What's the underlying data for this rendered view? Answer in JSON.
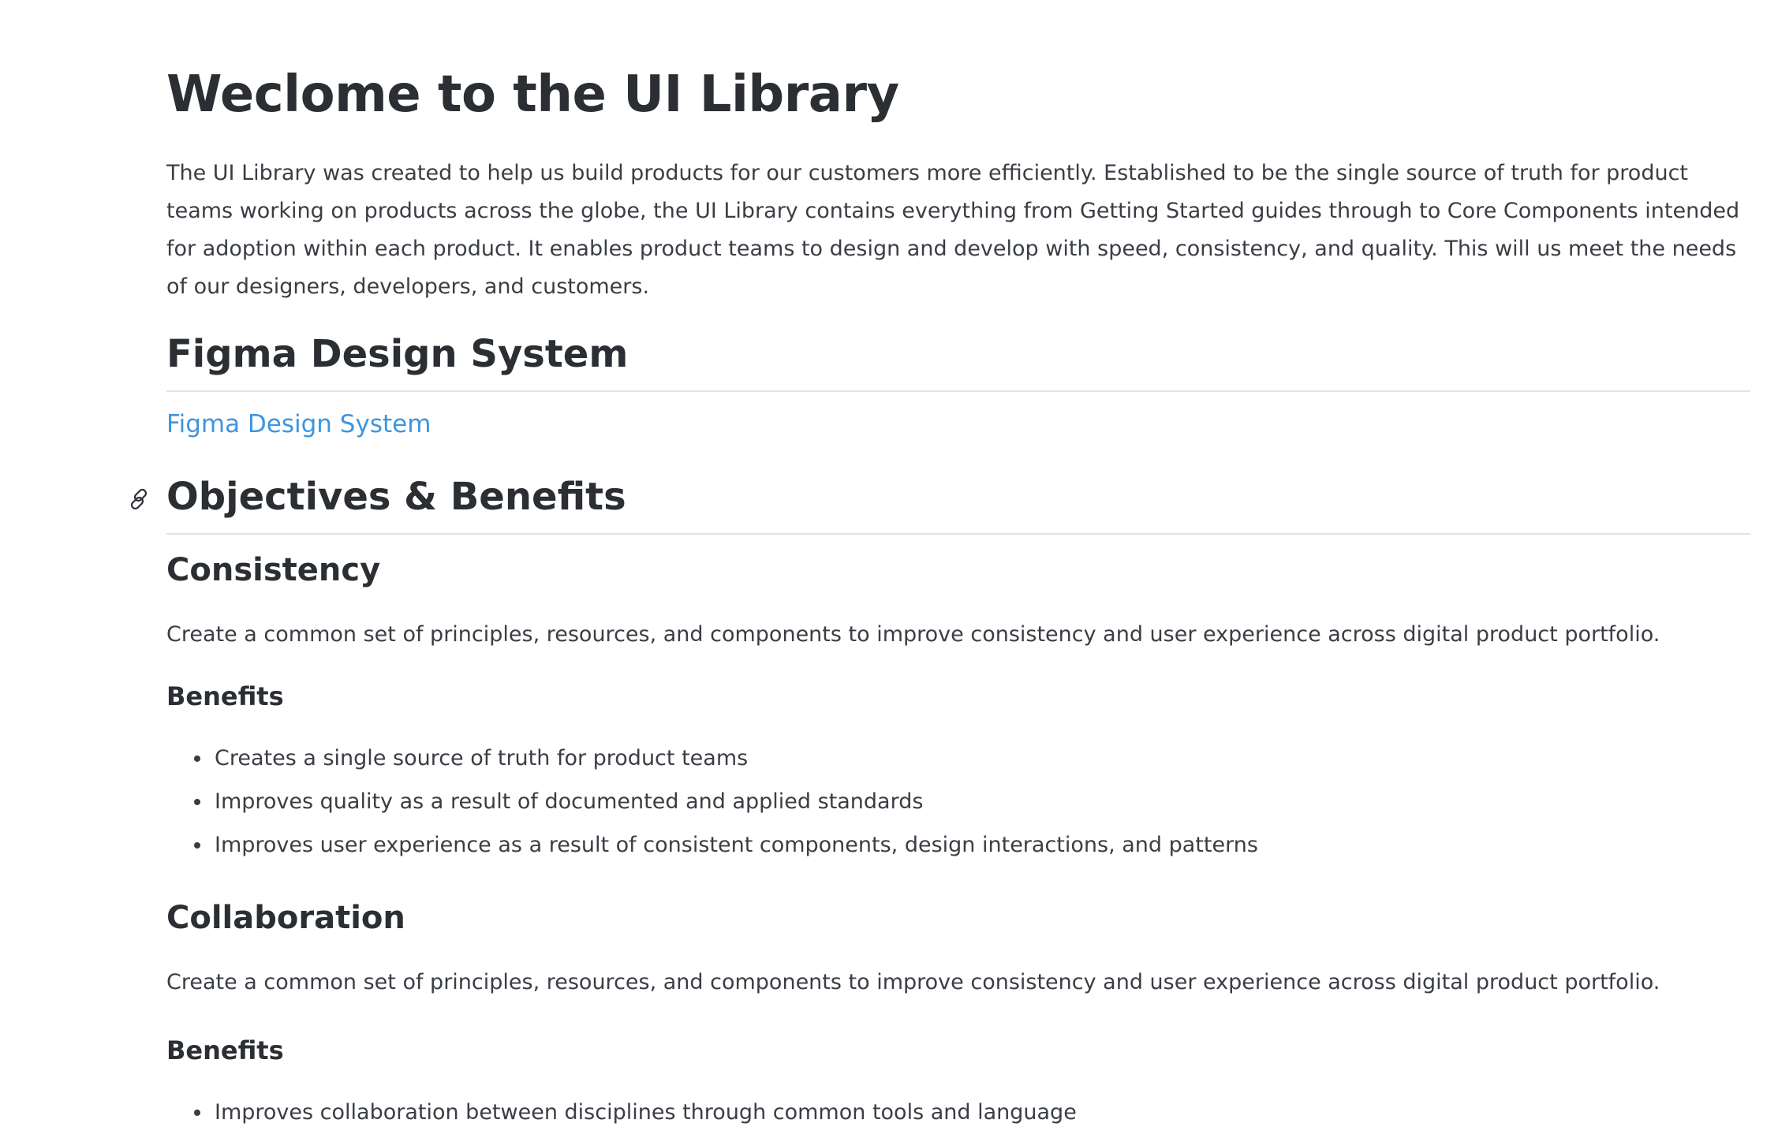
{
  "page": {
    "title": "Weclome to the UI Library",
    "intro": "The UI Library was created to help us build products for our customers more efficiently. Established to be the single source of truth for product teams working on products across the globe, the UI Library contains everything from Getting Started guides through to Core Components intended for adoption within each product. It enables product teams to design and develop with speed, consistency, and quality. This will us meet the needs of our designers, developers, and customers."
  },
  "figma_section": {
    "heading": "Figma Design System",
    "link_label": "Figma Design System"
  },
  "objectives_section": {
    "heading": "Objectives & Benefits",
    "anchor_icon": "link-icon",
    "subsections": [
      {
        "heading": "Consistency",
        "description": "Create a common set of principles, resources, and components to improve consistency and user experience across digital product portfolio.",
        "benefits_heading": "Benefits",
        "benefits": [
          "Creates a single source of truth for product teams",
          "Improves quality as a result of documented and applied standards",
          "Improves user experience as a result of consistent components, design interactions, and patterns"
        ]
      },
      {
        "heading": "Collaboration",
        "description": "Create a common set of principles, resources, and components to improve consistency and user experience across digital product portfolio.",
        "benefits_heading": "Benefits",
        "benefits": [
          "Improves collaboration between disciplines through common tools and language"
        ]
      }
    ]
  },
  "colors": {
    "text": "#2e3136",
    "link": "#3e95e0",
    "divider": "#e1e3e6"
  }
}
